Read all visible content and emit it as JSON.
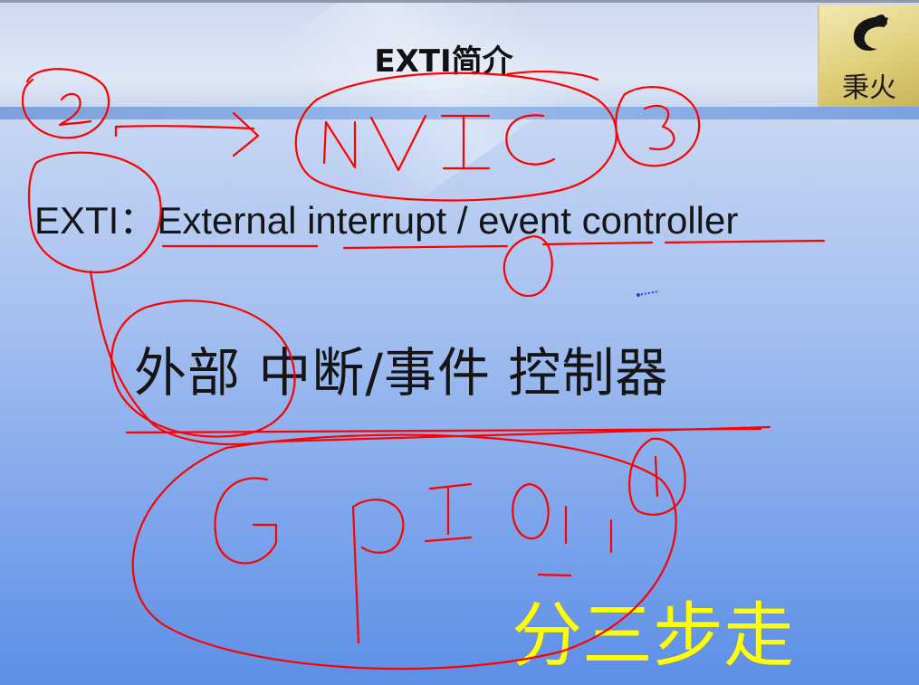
{
  "slide": {
    "title": "EXTI简介",
    "subtitle": "EXTI：External interrupt / event controller",
    "chinese_line": "外部 中断/事件 控制器",
    "caption": "分三步走"
  },
  "logo": {
    "text": "秉火",
    "icon": "flame-logo-icon"
  },
  "annotations": {
    "color": "#ff0000",
    "handwritten": [
      "2",
      "NVIC",
      "3",
      "1",
      "GPIO",
      "0",
      "1"
    ]
  },
  "colors": {
    "caption": "#ffff00",
    "ink": "#ff0000"
  }
}
